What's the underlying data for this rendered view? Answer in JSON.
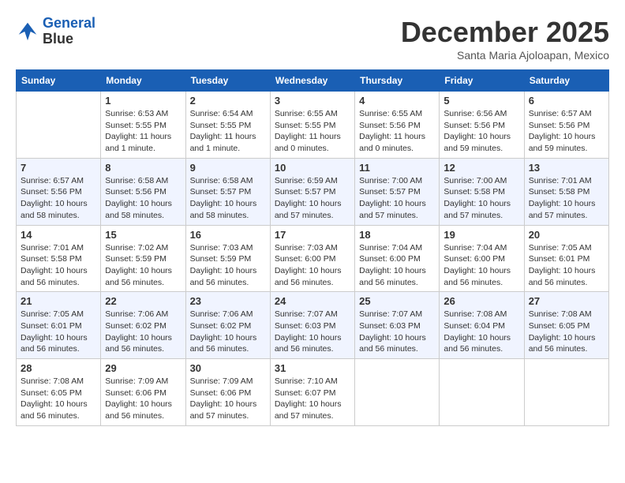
{
  "logo": {
    "line1": "General",
    "line2": "Blue"
  },
  "title": "December 2025",
  "subtitle": "Santa Maria Ajoloapan, Mexico",
  "days_of_week": [
    "Sunday",
    "Monday",
    "Tuesday",
    "Wednesday",
    "Thursday",
    "Friday",
    "Saturday"
  ],
  "weeks": [
    [
      {
        "day": "",
        "info": ""
      },
      {
        "day": "1",
        "info": "Sunrise: 6:53 AM\nSunset: 5:55 PM\nDaylight: 11 hours\nand 1 minute."
      },
      {
        "day": "2",
        "info": "Sunrise: 6:54 AM\nSunset: 5:55 PM\nDaylight: 11 hours\nand 1 minute."
      },
      {
        "day": "3",
        "info": "Sunrise: 6:55 AM\nSunset: 5:55 PM\nDaylight: 11 hours\nand 0 minutes."
      },
      {
        "day": "4",
        "info": "Sunrise: 6:55 AM\nSunset: 5:56 PM\nDaylight: 11 hours\nand 0 minutes."
      },
      {
        "day": "5",
        "info": "Sunrise: 6:56 AM\nSunset: 5:56 PM\nDaylight: 10 hours\nand 59 minutes."
      },
      {
        "day": "6",
        "info": "Sunrise: 6:57 AM\nSunset: 5:56 PM\nDaylight: 10 hours\nand 59 minutes."
      }
    ],
    [
      {
        "day": "7",
        "info": "Sunrise: 6:57 AM\nSunset: 5:56 PM\nDaylight: 10 hours\nand 58 minutes."
      },
      {
        "day": "8",
        "info": "Sunrise: 6:58 AM\nSunset: 5:56 PM\nDaylight: 10 hours\nand 58 minutes."
      },
      {
        "day": "9",
        "info": "Sunrise: 6:58 AM\nSunset: 5:57 PM\nDaylight: 10 hours\nand 58 minutes."
      },
      {
        "day": "10",
        "info": "Sunrise: 6:59 AM\nSunset: 5:57 PM\nDaylight: 10 hours\nand 57 minutes."
      },
      {
        "day": "11",
        "info": "Sunrise: 7:00 AM\nSunset: 5:57 PM\nDaylight: 10 hours\nand 57 minutes."
      },
      {
        "day": "12",
        "info": "Sunrise: 7:00 AM\nSunset: 5:58 PM\nDaylight: 10 hours\nand 57 minutes."
      },
      {
        "day": "13",
        "info": "Sunrise: 7:01 AM\nSunset: 5:58 PM\nDaylight: 10 hours\nand 57 minutes."
      }
    ],
    [
      {
        "day": "14",
        "info": "Sunrise: 7:01 AM\nSunset: 5:58 PM\nDaylight: 10 hours\nand 56 minutes."
      },
      {
        "day": "15",
        "info": "Sunrise: 7:02 AM\nSunset: 5:59 PM\nDaylight: 10 hours\nand 56 minutes."
      },
      {
        "day": "16",
        "info": "Sunrise: 7:03 AM\nSunset: 5:59 PM\nDaylight: 10 hours\nand 56 minutes."
      },
      {
        "day": "17",
        "info": "Sunrise: 7:03 AM\nSunset: 6:00 PM\nDaylight: 10 hours\nand 56 minutes."
      },
      {
        "day": "18",
        "info": "Sunrise: 7:04 AM\nSunset: 6:00 PM\nDaylight: 10 hours\nand 56 minutes."
      },
      {
        "day": "19",
        "info": "Sunrise: 7:04 AM\nSunset: 6:00 PM\nDaylight: 10 hours\nand 56 minutes."
      },
      {
        "day": "20",
        "info": "Sunrise: 7:05 AM\nSunset: 6:01 PM\nDaylight: 10 hours\nand 56 minutes."
      }
    ],
    [
      {
        "day": "21",
        "info": "Sunrise: 7:05 AM\nSunset: 6:01 PM\nDaylight: 10 hours\nand 56 minutes."
      },
      {
        "day": "22",
        "info": "Sunrise: 7:06 AM\nSunset: 6:02 PM\nDaylight: 10 hours\nand 56 minutes."
      },
      {
        "day": "23",
        "info": "Sunrise: 7:06 AM\nSunset: 6:02 PM\nDaylight: 10 hours\nand 56 minutes."
      },
      {
        "day": "24",
        "info": "Sunrise: 7:07 AM\nSunset: 6:03 PM\nDaylight: 10 hours\nand 56 minutes."
      },
      {
        "day": "25",
        "info": "Sunrise: 7:07 AM\nSunset: 6:03 PM\nDaylight: 10 hours\nand 56 minutes."
      },
      {
        "day": "26",
        "info": "Sunrise: 7:08 AM\nSunset: 6:04 PM\nDaylight: 10 hours\nand 56 minutes."
      },
      {
        "day": "27",
        "info": "Sunrise: 7:08 AM\nSunset: 6:05 PM\nDaylight: 10 hours\nand 56 minutes."
      }
    ],
    [
      {
        "day": "28",
        "info": "Sunrise: 7:08 AM\nSunset: 6:05 PM\nDaylight: 10 hours\nand 56 minutes."
      },
      {
        "day": "29",
        "info": "Sunrise: 7:09 AM\nSunset: 6:06 PM\nDaylight: 10 hours\nand 56 minutes."
      },
      {
        "day": "30",
        "info": "Sunrise: 7:09 AM\nSunset: 6:06 PM\nDaylight: 10 hours\nand 57 minutes."
      },
      {
        "day": "31",
        "info": "Sunrise: 7:10 AM\nSunset: 6:07 PM\nDaylight: 10 hours\nand 57 minutes."
      },
      {
        "day": "",
        "info": ""
      },
      {
        "day": "",
        "info": ""
      },
      {
        "day": "",
        "info": ""
      }
    ]
  ]
}
